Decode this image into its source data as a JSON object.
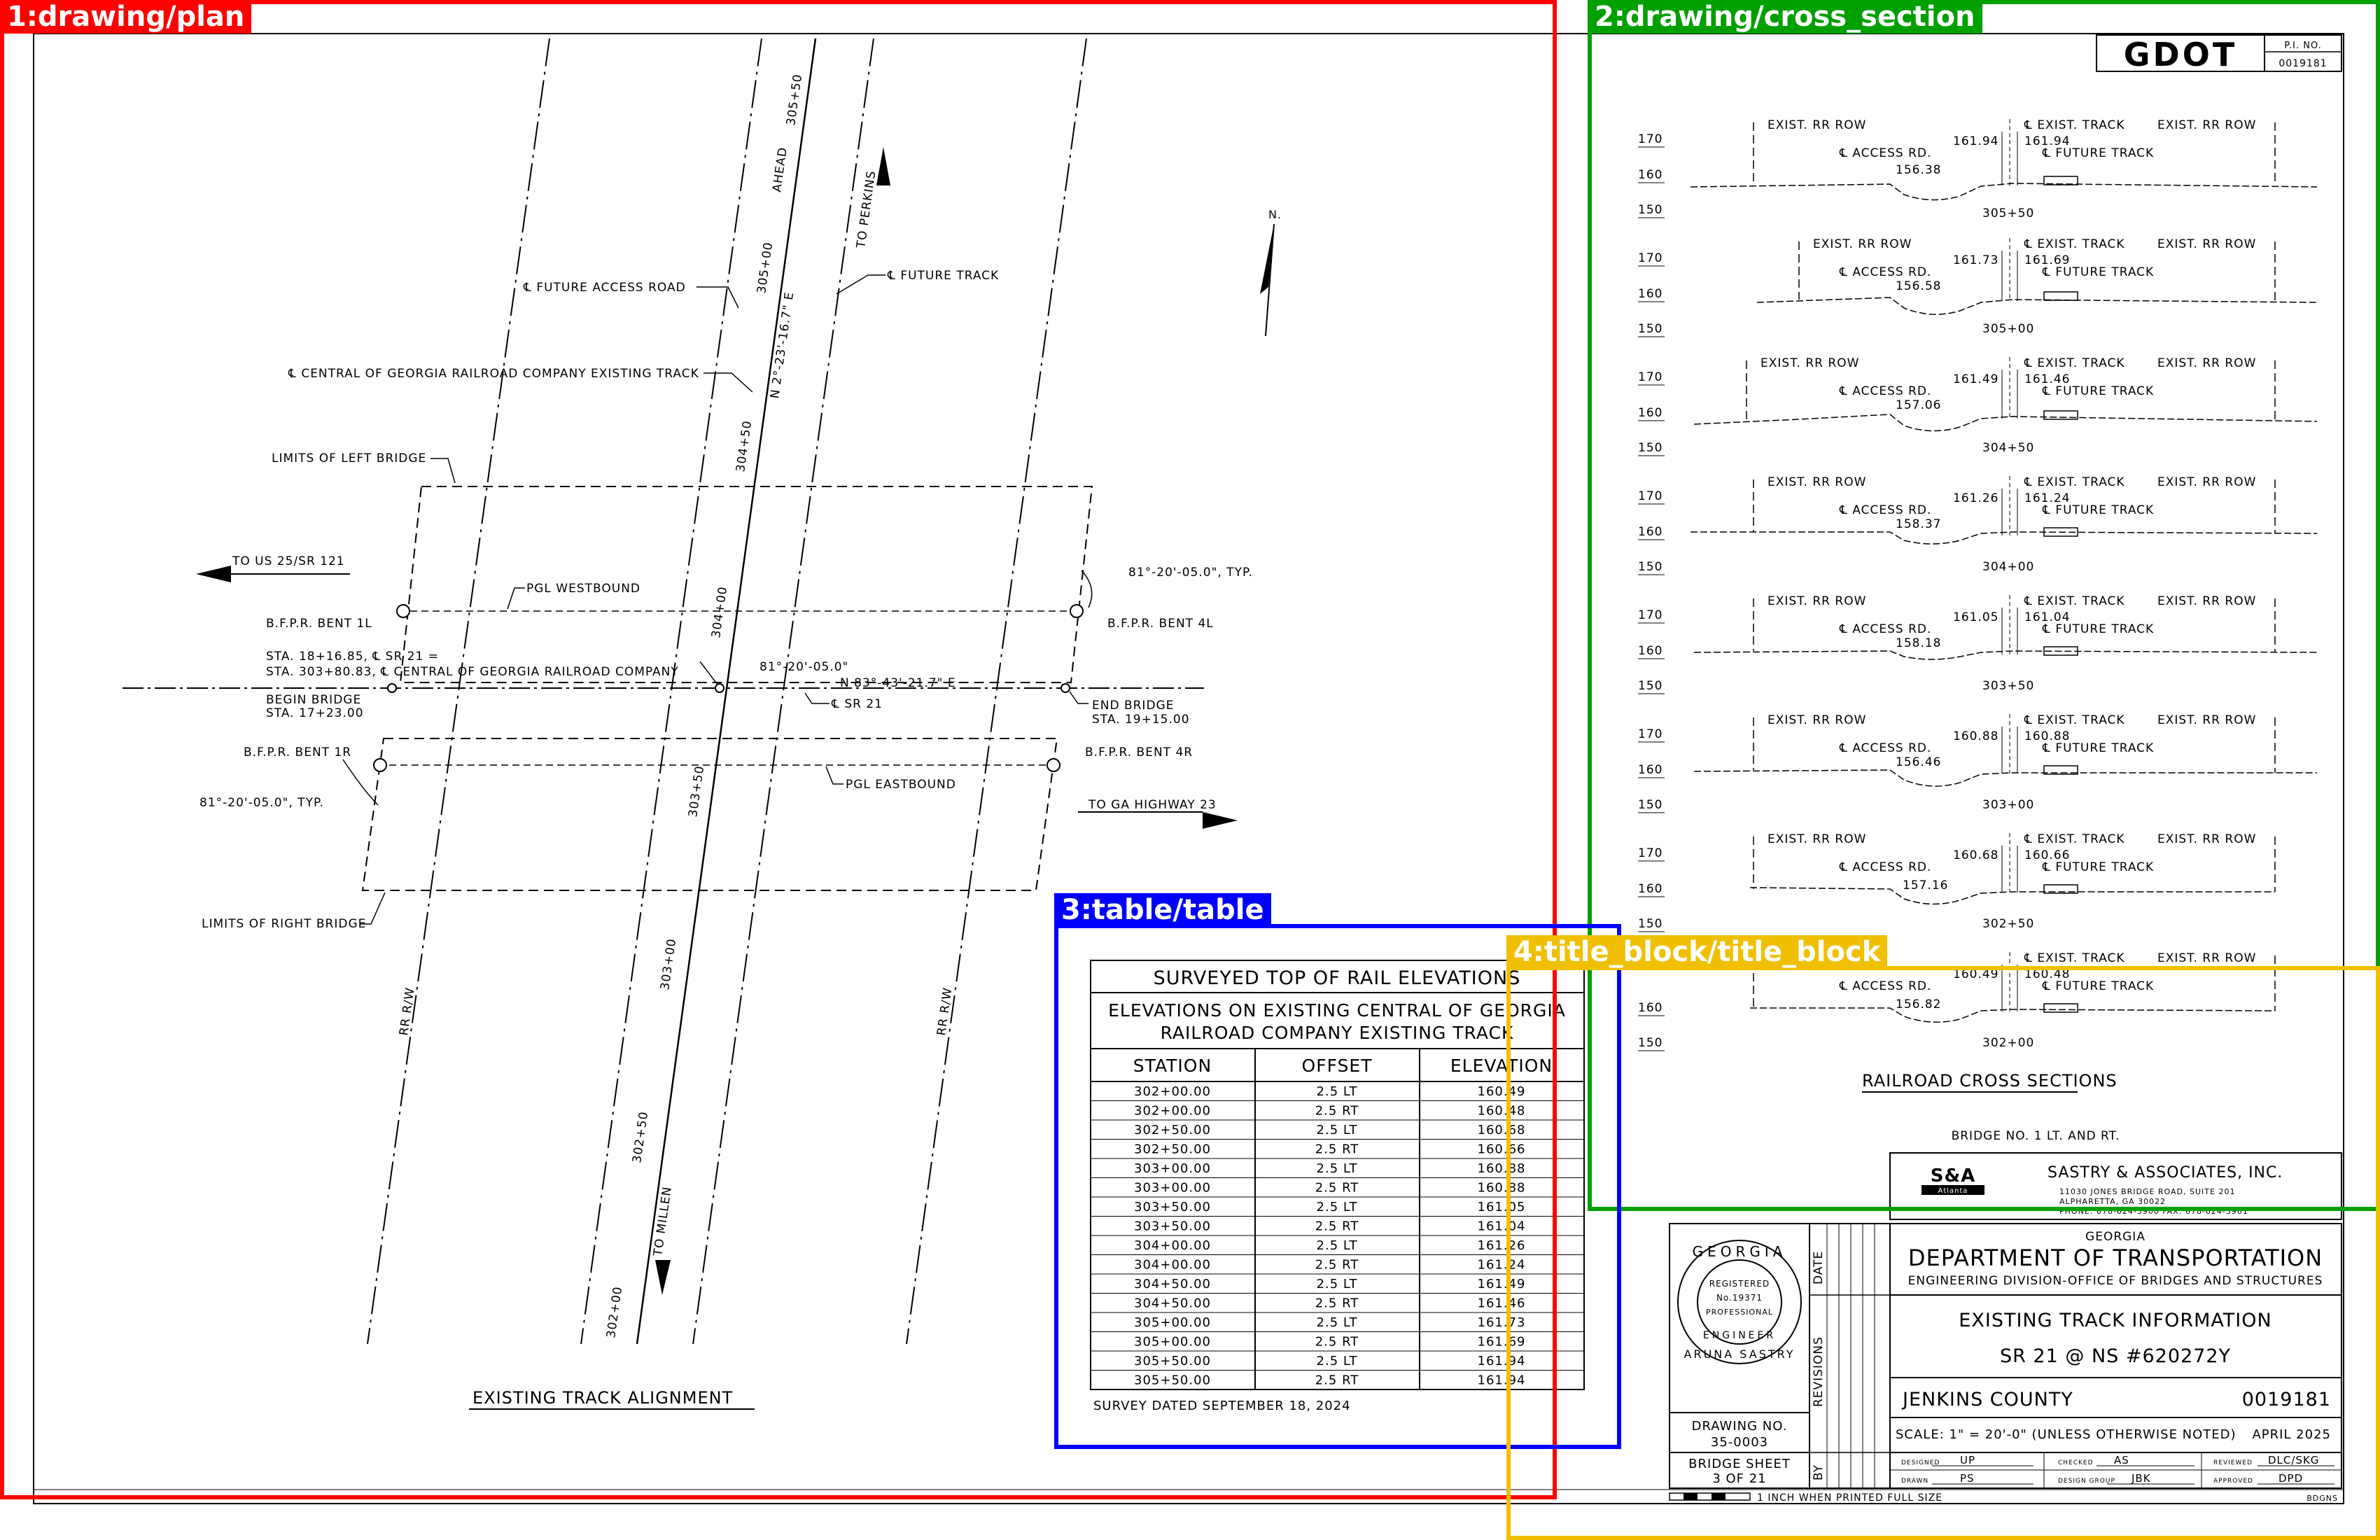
{
  "plan": {
    "title": "EXISTING TRACK ALIGNMENT",
    "north": "N.",
    "labels": {
      "future_access_road": "℄ FUTURE ACCESS ROAD",
      "future_track": "℄ FUTURE TRACK",
      "central_existing": "℄ CENTRAL OF GEORGIA RAILROAD COMPANY EXISTING TRACK",
      "limits_left": "LIMITS OF LEFT BRIDGE",
      "limits_right": "LIMITS OF RIGHT BRIDGE",
      "to_us25": "TO US 25/SR 121",
      "to_ga23": "TO GA HIGHWAY 23",
      "to_perkins": "TO PERKINS",
      "to_millen": "TO MILLEN",
      "ahead": "AHEAD",
      "pgl_wb": "PGL WESTBOUND",
      "pgl_eb": "PGL EASTBOUND",
      "bent_1l": "B.F.P.R. BENT 1L",
      "bent_4l": "B.F.P.R. BENT 4L",
      "bent_1r": "B.F.P.R. BENT 1R",
      "bent_4r": "B.F.P.R. BENT 4R",
      "angle_typ_right": "81°-20'-05.0\", TYP.",
      "angle_typ_left": "81°-20'-05.0\", TYP.",
      "angle_center": "81°-20'-05.0\"",
      "sta_eq_1": "STA. 18+16.85, ℄ SR 21 =",
      "sta_eq_2": "STA. 303+80.83, ℄ CENTRAL OF GEORGIA RAILROAD COMPANY",
      "bearing_sr21": "N 83°-43'-21.7\" E",
      "bearing_track": "N 2°-23'-16.7\" E",
      "cl_sr21": "℄ SR 21",
      "begin_bridge_1": "BEGIN BRIDGE",
      "begin_bridge_2": "STA. 17+23.00",
      "end_bridge_1": "END BRIDGE",
      "end_bridge_2": "STA. 19+15.00",
      "rr_rw": "RR R/W",
      "stations": [
        "305+50",
        "305+00",
        "304+50",
        "304+00",
        "303+50",
        "303+00",
        "302+50",
        "302+00"
      ]
    }
  },
  "sections": {
    "title": "RAILROAD CROSS SECTIONS",
    "subtitle": "BRIDGE NO. 1 LT. AND RT.",
    "labels": {
      "exist_rr_row": "EXIST. RR ROW",
      "exist_track": "℄ EXIST. TRACK",
      "access_rd": "℄ ACCESS RD.",
      "future_track": "℄ FUTURE TRACK"
    },
    "items": [
      {
        "station": "305+50",
        "left": "161.94",
        "right": "161.94",
        "access": "156.38",
        "axis": [
          "170",
          "160",
          "150"
        ]
      },
      {
        "station": "305+00",
        "left": "161.73",
        "right": "161.69",
        "access": "156.58",
        "axis": [
          "170",
          "160",
          "150"
        ]
      },
      {
        "station": "304+50",
        "left": "161.49",
        "right": "161.46",
        "access": "157.06",
        "axis": [
          "170",
          "160",
          "150"
        ]
      },
      {
        "station": "304+00",
        "left": "161.26",
        "right": "161.24",
        "access": "158.37",
        "axis": [
          "170",
          "160",
          "150"
        ]
      },
      {
        "station": "303+50",
        "left": "161.05",
        "right": "161.04",
        "access": "158.18",
        "axis": [
          "170",
          "160",
          "150"
        ]
      },
      {
        "station": "303+00",
        "left": "160.88",
        "right": "160.88",
        "access": "156.46",
        "axis": [
          "170",
          "160",
          "150"
        ]
      },
      {
        "station": "302+50",
        "left": "160.68",
        "right": "160.66",
        "access": "157.16",
        "axis": [
          "170",
          "160",
          "150"
        ]
      },
      {
        "station": "302+00",
        "left": "160.49",
        "right": "160.48",
        "access": "156.82",
        "axis": [
          "170",
          "160",
          "150"
        ]
      }
    ]
  },
  "table": {
    "title": "SURVEYED TOP OF RAIL ELEVATIONS",
    "subtitle_1": "ELEVATIONS ON EXISTING CENTRAL OF GEORGIA",
    "subtitle_2": "RAILROAD COMPANY EXISTING TRACK",
    "headers": [
      "STATION",
      "OFFSET",
      "ELEVATION"
    ],
    "rows": [
      [
        "302+00.00",
        "2.5 LT",
        "160.49"
      ],
      [
        "302+00.00",
        "2.5 RT",
        "160.48"
      ],
      [
        "302+50.00",
        "2.5 LT",
        "160.68"
      ],
      [
        "302+50.00",
        "2.5 RT",
        "160.66"
      ],
      [
        "303+00.00",
        "2.5 LT",
        "160.88"
      ],
      [
        "303+00.00",
        "2.5 RT",
        "160.88"
      ],
      [
        "303+50.00",
        "2.5 LT",
        "161.05"
      ],
      [
        "303+50.00",
        "2.5 RT",
        "161.04"
      ],
      [
        "304+00.00",
        "2.5 LT",
        "161.26"
      ],
      [
        "304+00.00",
        "2.5 RT",
        "161.24"
      ],
      [
        "304+50.00",
        "2.5 LT",
        "161.49"
      ],
      [
        "304+50.00",
        "2.5 RT",
        "161.46"
      ],
      [
        "305+00.00",
        "2.5 LT",
        "161.73"
      ],
      [
        "305+00.00",
        "2.5 RT",
        "161.69"
      ],
      [
        "305+50.00",
        "2.5 LT",
        "161.94"
      ],
      [
        "305+50.00",
        "2.5 RT",
        "161.94"
      ]
    ],
    "footer": "SURVEY DATED SEPTEMBER 18, 2024"
  },
  "title_block": {
    "logo": "GDOT",
    "pi_label": "P.I. NO.",
    "pi_no": "0019181",
    "firm_logo": "S&A",
    "firm_logo_sub": "Atlanta",
    "firm": "SASTRY & ASSOCIATES, INC.",
    "firm_addr1": "11030 JONES BRIDGE ROAD, SUITE 201",
    "firm_addr2": "ALPHARETTA, GA 30022",
    "firm_addr3": "PHONE: 678-624-3900   FAX: 678-624-3901",
    "state": "GEORGIA",
    "dept": "DEPARTMENT OF TRANSPORTATION",
    "division": "ENGINEERING DIVISION-OFFICE OF BRIDGES AND STRUCTURES",
    "sheet_title": "EXISTING TRACK INFORMATION",
    "sheet_sub": "SR 21 @ NS #620272Y",
    "county": "JENKINS COUNTY",
    "pi_no_2": "0019181",
    "scale": "SCALE: 1\" = 20'-0\" (UNLESS OTHERWISE NOTED)",
    "date": "APRIL 2025",
    "designed_label": "DESIGNED",
    "designed": "UP",
    "checked_label": "CHECKED",
    "checked": "AS",
    "reviewed_label": "REVIEWED",
    "reviewed": "DLC/SKG",
    "drawn_label": "DRAWN",
    "drawn": "PS",
    "design_group_label": "DESIGN GROUP",
    "design_group": "JBK",
    "approved_label": "APPROVED",
    "approved": "DPD",
    "drawing_no_label": "DRAWING NO.",
    "drawing_no": "35-0003",
    "bridge_sheet_label": "BRIDGE SHEET",
    "bridge_sheet": "3 OF 21",
    "col_date": "DATE",
    "col_revisions": "REVISIONS",
    "col_by": "BY",
    "seal_top": "GEORGIA",
    "seal_line1": "REGISTERED",
    "seal_line2": "No.19371",
    "seal_line3": "PROFESSIONAL",
    "seal_bottom": "ENGINEER",
    "seal_name": "ARUNA SASTRY",
    "scale_note": "1 INCH WHEN PRINTED FULL SIZE",
    "file_ref": "BDGNS"
  },
  "annotations": [
    {
      "label": "1:drawing/plan",
      "color": "#ff0000"
    },
    {
      "label": "2:drawing/cross_section",
      "color": "#00a000"
    },
    {
      "label": "3:table/table",
      "color": "#0000ff"
    },
    {
      "label": "4:title_block/title_block",
      "color": "#f0c000"
    }
  ]
}
